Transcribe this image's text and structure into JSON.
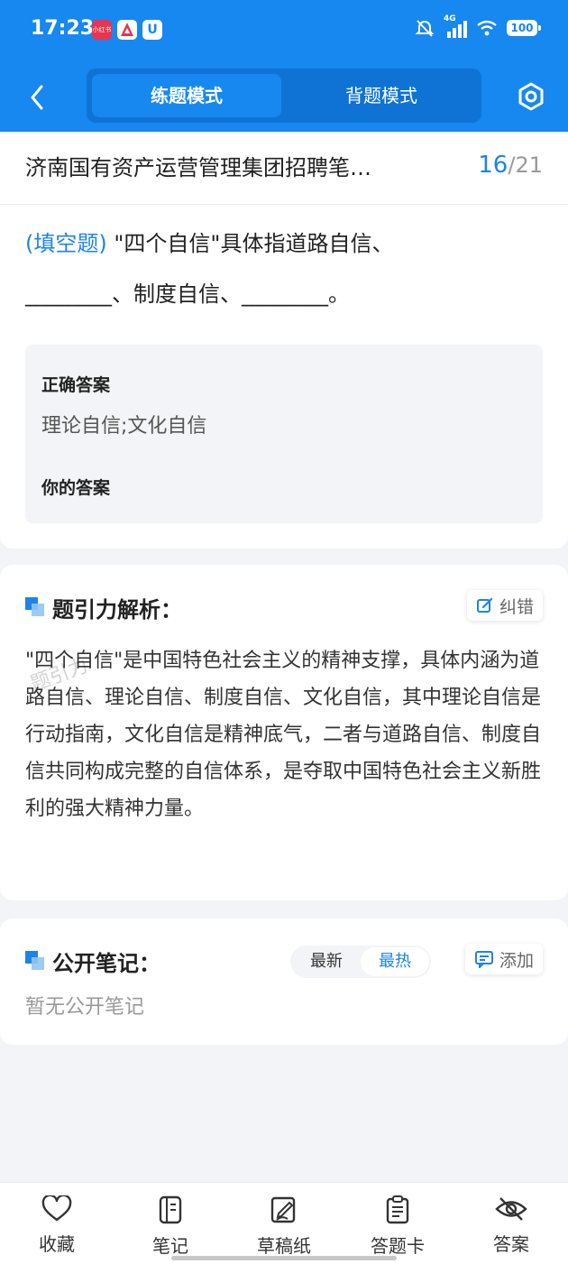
{
  "status_bar": {
    "time": "17:23",
    "apps": [
      "小红书",
      "",
      "U"
    ],
    "network": "4G",
    "battery": "100"
  },
  "nav": {
    "modes": [
      "练题模式",
      "背题模式"
    ],
    "active_mode": "练题模式"
  },
  "question": {
    "title": "济南国有资产运营管理集团招聘笔…",
    "current": "16",
    "separator": "/",
    "total": "21",
    "type_label": "(填空题)",
    "text_part1": " \"四个自信\"具体指道路自信、",
    "blank": "________",
    "text_part2": "、制度自信、",
    "text_part3": "。",
    "correct_answer_label": "正确答案",
    "correct_answer": "理论自信;文化自信",
    "your_answer_label": "你的答案"
  },
  "analysis": {
    "title": "题引力解析：",
    "report_label": "纠错",
    "text": "\"四个自信\"是中国特色社会主义的精神支撑，具体内涵为道路自信、理论自信、制度自信、文化自信，其中理论自信是行动指南，文化自信是精神底气，二者与道路自信、制度自信共同构成完整的自信体系，是夺取中国特色社会主义新胜利的强大精神力量。",
    "watermark": "题引力"
  },
  "notes": {
    "title": "公开笔记：",
    "sort_newest": "最新",
    "sort_hottest": "最热",
    "add_label": "添加",
    "empty": "暂无公开笔记"
  },
  "bottom_bar": {
    "items": [
      "收藏",
      "笔记",
      "草稿纸",
      "答题卡",
      "答案"
    ]
  },
  "colors": {
    "brand": "#1688f0",
    "accent": "#1e83e8"
  }
}
